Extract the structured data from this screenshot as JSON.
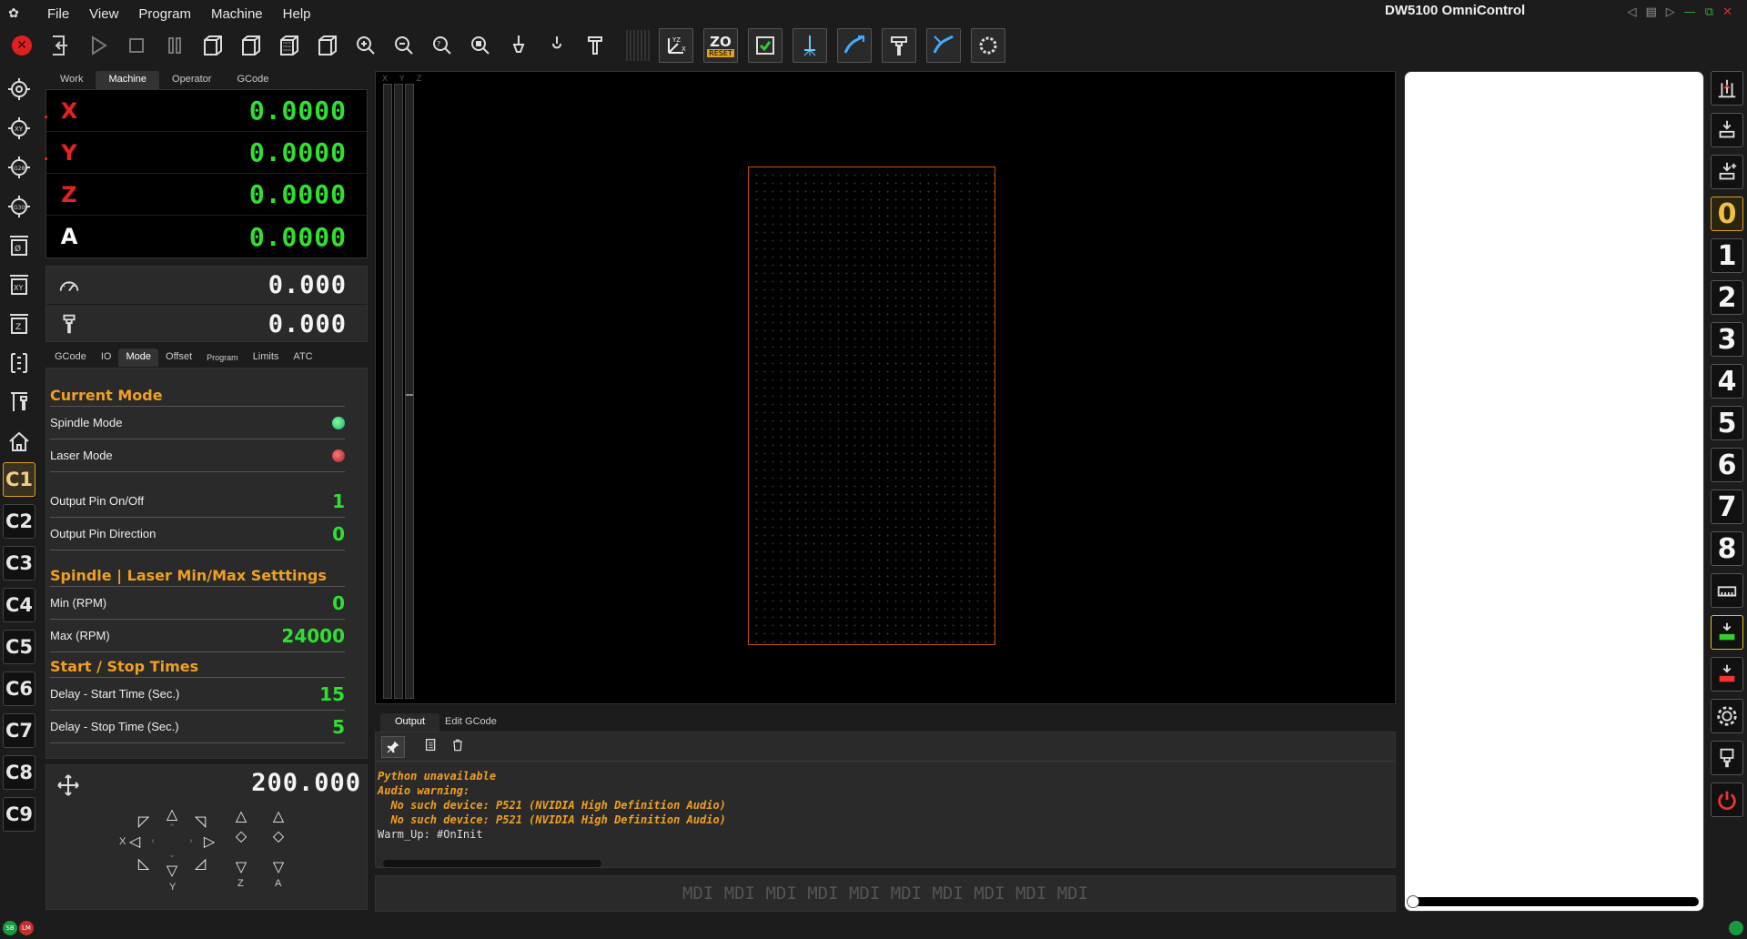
{
  "menubar": {
    "items": [
      "File",
      "View",
      "Program",
      "Machine",
      "Help"
    ],
    "title": "DW5100 OmniControl"
  },
  "toolbar": {
    "zo_label": "ZO",
    "reset_label": "RESET"
  },
  "left_column": {
    "c_buttons": [
      "C1",
      "C2",
      "C3",
      "C4",
      "C5",
      "C6",
      "C7",
      "C8",
      "C9"
    ],
    "active": "C1"
  },
  "dro": {
    "tabs": [
      "Work",
      "Machine",
      "Operator",
      "GCode"
    ],
    "active_tab": "Machine",
    "axes": [
      {
        "letter": "X",
        "value": "0.0000",
        "color": "#e82020"
      },
      {
        "letter": "Y",
        "value": "0.0000",
        "color": "#e82020"
      },
      {
        "letter": "Z",
        "value": "0.0000",
        "color": "#e82020"
      },
      {
        "letter": "A",
        "value": "0.0000",
        "color": "#ffffff"
      }
    ],
    "feed_value": "0.000",
    "spindle_value": "0.000"
  },
  "mode_panel": {
    "tabs": [
      "GCode",
      "IO",
      "Mode",
      "Offset",
      "Program",
      "Limits",
      "ATC"
    ],
    "active_tab": "Mode",
    "current_mode_title": "Current Mode",
    "spindle_mode_label": "Spindle Mode",
    "spindle_mode_state": "on",
    "laser_mode_label": "Laser Mode",
    "laser_mode_state": "off",
    "output_pin_onoff_label": "Output Pin On/Off",
    "output_pin_onoff_value": "1",
    "output_pin_direction_label": "Output Pin Direction",
    "output_pin_direction_value": "0",
    "minmax_title": "Spindle | Laser Min/Max Setttings",
    "min_label": "Min (RPM)",
    "min_value": "0",
    "max_label": "Max (RPM)",
    "max_value": "24000",
    "times_title": "Start / Stop Times",
    "start_delay_label": "Delay - Start Time (Sec.)",
    "start_delay_value": "15",
    "stop_delay_label": "Delay - Stop Time (Sec.)",
    "stop_delay_value": "5"
  },
  "jog": {
    "step_value": "200.000",
    "labels": {
      "x": "X",
      "y": "Y",
      "z": "Z",
      "a": "A"
    }
  },
  "viewport": {
    "axis_labels": "X Y Z"
  },
  "output": {
    "tabs": [
      "Output",
      "Edit GCode"
    ],
    "active_tab": "Output",
    "lines": [
      {
        "text": "Python unavailable",
        "kind": "warn"
      },
      {
        "text": "Audio warning:",
        "kind": "warn"
      },
      {
        "text": "  No such device: P521 (NVIDIA High Definition Audio)",
        "kind": "warn"
      },
      {
        "text": "  No such device: P521 (NVIDIA High Definition Audio)",
        "kind": "warn"
      },
      {
        "text": "Warm_Up: #OnInit",
        "kind": "norm"
      }
    ]
  },
  "mdi": {
    "placeholder_text": "MDI MDI MDI MDI MDI MDI MDI MDI MDI MDI"
  },
  "right_column": {
    "tool_numbers": [
      "0",
      "1",
      "2",
      "3",
      "4",
      "5",
      "6",
      "7",
      "8"
    ],
    "active_tool": "0"
  },
  "statusbar": {
    "left_leds": [
      {
        "label": "SB",
        "color": "#1a9a40"
      },
      {
        "label": "LM",
        "color": "#c03030"
      }
    ]
  },
  "colors": {
    "accent": "#f0a020",
    "dro_green": "#30e030",
    "estop_red": "#e02020"
  }
}
